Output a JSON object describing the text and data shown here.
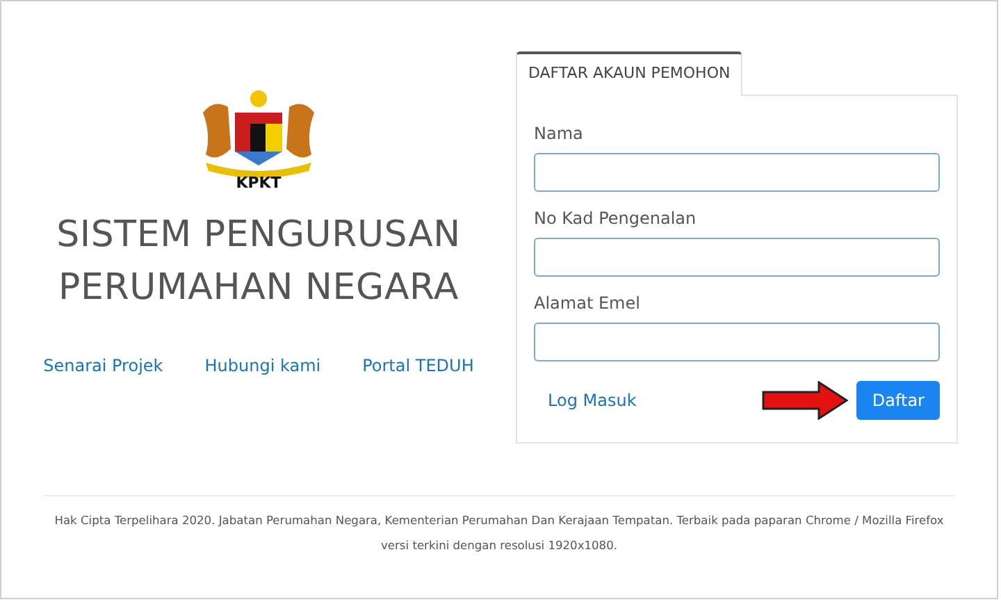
{
  "logo": {
    "caption": "KPKT"
  },
  "title_lines": [
    "SISTEM PENGURUSAN",
    "PERUMAHAN NEGARA"
  ],
  "links": [
    "Senarai Projek",
    "Hubungi kami",
    "Portal TEDUH"
  ],
  "form": {
    "tab": "DAFTAR AKAUN PEMOHON",
    "fields": [
      {
        "label": "Nama"
      },
      {
        "label": "No Kad Pengenalan"
      },
      {
        "label": "Alamat Emel"
      }
    ],
    "login_link": "Log Masuk",
    "submit": "Daftar"
  },
  "footer": [
    "Hak Cipta Terpelihara 2020. Jabatan Perumahan Negara, Kementerian Perumahan Dan Kerajaan Tempatan. Terbaik pada paparan Chrome / Mozilla Firefox",
    "versi terkini dengan resolusi 1920x1080."
  ]
}
